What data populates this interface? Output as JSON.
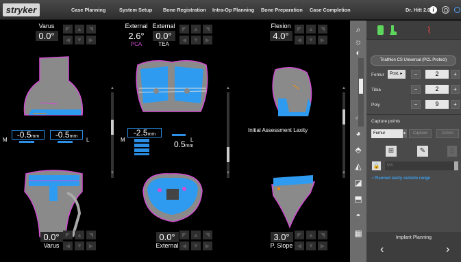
{
  "brand": "stryker",
  "nav": {
    "tabs": [
      "Case Planning",
      "System Setup",
      "Bone Registration",
      "Intra-Op Planning",
      "Bone Preparation",
      "Case Completion"
    ]
  },
  "user": {
    "name": "Dr. Hitt 2.0"
  },
  "views": {
    "top_left": {
      "label": "Varus",
      "value": "0.0°"
    },
    "top_center_a": {
      "label": "External",
      "value": "2.6°",
      "sub": "PCA"
    },
    "top_center_b": {
      "label": "External",
      "value": "0.0°",
      "sub": "TEA"
    },
    "top_right": {
      "label": "Flexion",
      "value": "4.0°"
    },
    "bottom_left": {
      "label": "Varus",
      "value": "0.0°"
    },
    "bottom_center": {
      "label": "External",
      "value": "0.0°"
    },
    "bottom_right": {
      "label": "P. Slope",
      "value": "3.0°"
    }
  },
  "gaps": {
    "m_label": "M",
    "l_label": "L",
    "left_medial": {
      "value": "-0.5",
      "unit": "mm"
    },
    "left_lateral": {
      "value": "-0.5",
      "unit": "mm"
    },
    "center_medial": {
      "value": "-2.5",
      "unit": "mm"
    },
    "center_lateral": {
      "value": "0.5",
      "unit": "mm"
    },
    "center_m_label": "M",
    "center_l_label": "L"
  },
  "assessment_label": "Initial Assessment Laxity",
  "panel": {
    "implant": "Triathlon CS Universal (PCL Protect)",
    "femur": {
      "label": "Femur",
      "type": "Post.",
      "size": "2"
    },
    "tibia": {
      "label": "Tibia",
      "size": "2"
    },
    "poly": {
      "label": "Poly",
      "size": "9"
    },
    "capture_title": "Capture points",
    "capture_select": "Femur",
    "capture_button": "Capture",
    "delete_button": "Delete",
    "ma_placeholder": "MA",
    "note": "• Planned laxity outside range",
    "planning_title": "Implant Planning",
    "prev": "‹",
    "next": "›"
  },
  "colors": {
    "accent": "#2b8fe6",
    "bone_outline": "#d34cd3",
    "implant": "#2e9bf0",
    "pca": "#d34cd3",
    "panel_green": "#5ed65e",
    "panel_red": "#e04040"
  }
}
